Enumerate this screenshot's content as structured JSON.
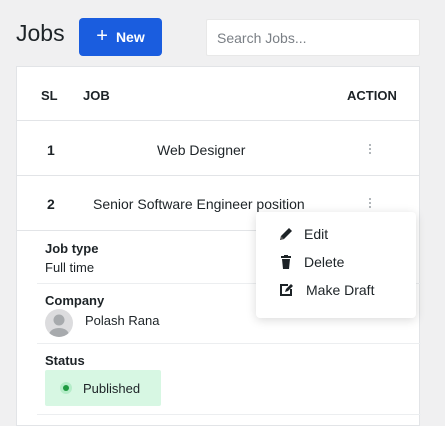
{
  "header": {
    "title": "Jobs",
    "new_label": "New",
    "search_placeholder": "Search Jobs..."
  },
  "table": {
    "columns": {
      "sl": "SL",
      "job": "JOB",
      "action": "ACTION"
    },
    "rows": [
      {
        "sl": "1",
        "job": "Web Designer"
      },
      {
        "sl": "2",
        "job": "Senior Software Engineer position"
      }
    ]
  },
  "detail": {
    "job_type_label": "Job type",
    "job_type_value": "Full time",
    "company_label": "Company",
    "company_name": "Polash Rana",
    "status_label": "Status",
    "status_value": "Published"
  },
  "action_menu": {
    "items": [
      {
        "label": "Edit",
        "icon": "pencil-icon"
      },
      {
        "label": "Delete",
        "icon": "trash-icon"
      },
      {
        "label": "Make Draft",
        "icon": "edit-square-icon"
      }
    ]
  },
  "colors": {
    "primary": "#1a5ddf",
    "status_bg": "#d7f7e3",
    "status_dot": "#1f9a41"
  }
}
